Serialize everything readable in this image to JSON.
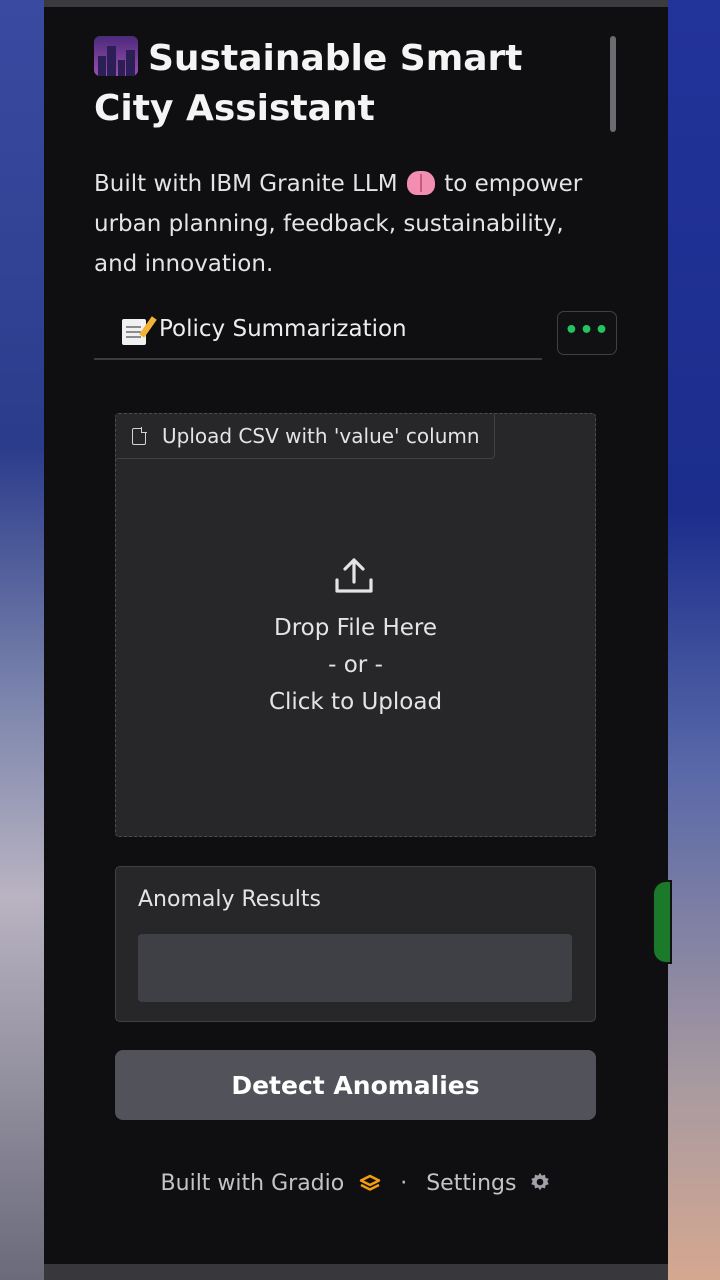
{
  "app": {
    "title": "Sustainable Smart City Assistant",
    "description_before": "Built with IBM Granite LLM",
    "description_after": "to empower urban planning, feedback, sustainability, and innovation."
  },
  "tabs": {
    "active_label": "Policy Summarization",
    "more_label": "•••"
  },
  "upload": {
    "label": "Upload CSV with 'value' column",
    "drop_text": "Drop File Here",
    "or_text": "- or -",
    "click_text": "Click to Upload"
  },
  "results": {
    "label": "Anomaly Results",
    "value": ""
  },
  "actions": {
    "detect_label": "Detect Anomalies"
  },
  "footer": {
    "built_with": "Built with Gradio",
    "separator": "·",
    "settings": "Settings"
  },
  "colors": {
    "accent_green": "#22c55e",
    "panel_bg": "#0f0f11",
    "card_bg": "#27272a",
    "button_bg": "#52525b"
  },
  "icons": [
    "cityscape-icon",
    "brain-icon",
    "memo-icon",
    "file-icon",
    "upload-icon",
    "gradio-icon",
    "gear-icon"
  ]
}
